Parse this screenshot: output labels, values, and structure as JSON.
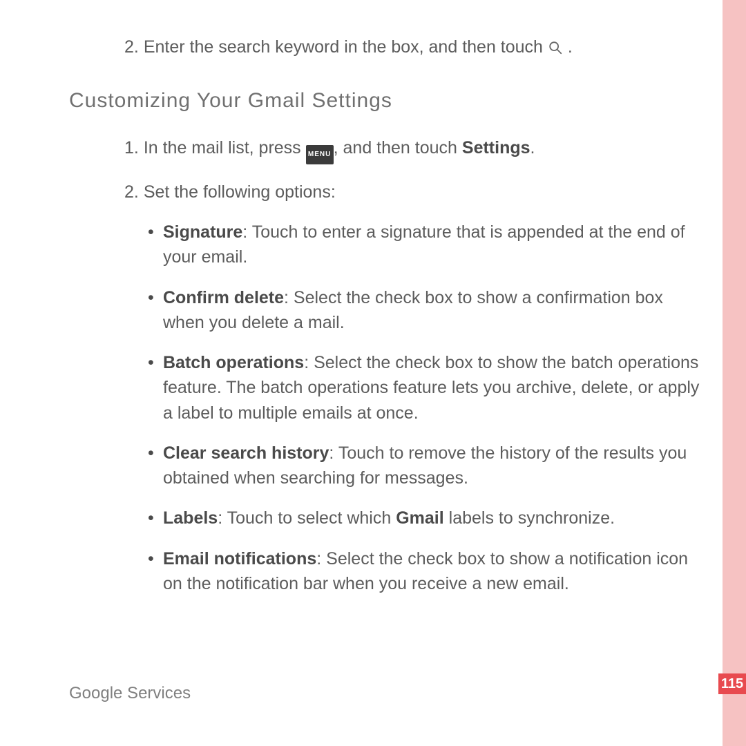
{
  "page_number": "115",
  "footer": "Google Services",
  "intro_step": {
    "number": "2.",
    "before_icon": "Enter the search keyword in the box, and then touch ",
    "after_icon": "."
  },
  "section_heading": "Customizing  Your  Gmail  Settings",
  "steps": {
    "step1": {
      "number": "1.",
      "before_icon": "In the mail list, press ",
      "after_icon": ", and then touch ",
      "bold": "Settings",
      "tail": "."
    },
    "step2": {
      "number": "2.",
      "text": "Set the following options:"
    }
  },
  "options": {
    "signature": {
      "label": "Signature",
      "text": ": Touch to enter a signature that is appended at the end of your email."
    },
    "confirm": {
      "label": "Confirm delete",
      "text": ": Select the check box to show a confirmation box when you delete a mail."
    },
    "batch": {
      "label": "Batch operations",
      "text": ": Select the check box to show the batch operations feature. The batch operations feature lets you archive, delete, or apply a label to multiple emails at once."
    },
    "clear": {
      "label": "Clear search history",
      "text": ": Touch to remove the history of the results you obtained when searching for messages."
    },
    "labels": {
      "label": "Labels",
      "before": ": Touch to select which ",
      "bold": "Gmail",
      "after": " labels to synchronize."
    },
    "notify": {
      "label": "Email notifications",
      "text": ": Select the check box to show a notification icon on the notification bar when you receive a new email."
    }
  },
  "icons": {
    "menu_label": "MENU"
  }
}
